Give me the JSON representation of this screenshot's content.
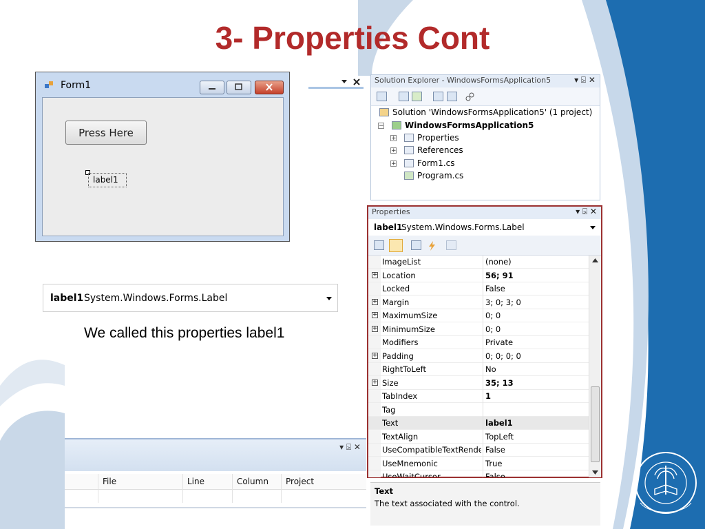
{
  "slide": {
    "title": "3- Properties Cont",
    "caption": "We called this properties label1"
  },
  "form1": {
    "title": "Form1",
    "button_label": "Press Here",
    "label_text": "label1"
  },
  "label_selector": {
    "name": "label1",
    "type": "System.Windows.Forms.Label"
  },
  "error_list": {
    "columns": [
      "File",
      "Line",
      "Column",
      "Project"
    ],
    "controls": "▾ ⍄ ✕"
  },
  "solution_explorer": {
    "title": "Solution Explorer - WindowsFormsApplication5",
    "controls": "▾ ⍄ ✕",
    "solution": "Solution 'WindowsFormsApplication5' (1 project)",
    "project": "WindowsFormsApplication5",
    "items": [
      "Properties",
      "References",
      "Form1.cs",
      "Program.cs"
    ]
  },
  "properties_panel": {
    "title": "Properties",
    "controls": "▾ ⍄ ✕",
    "object_name": "label1",
    "object_type": "System.Windows.Forms.Label",
    "rows": [
      {
        "name": "ImageList",
        "value": "(none)",
        "expandable": false,
        "bold": false
      },
      {
        "name": "Location",
        "value": "56; 91",
        "expandable": true,
        "bold": true
      },
      {
        "name": "Locked",
        "value": "False",
        "expandable": false,
        "bold": false
      },
      {
        "name": "Margin",
        "value": "3; 0; 3; 0",
        "expandable": true,
        "bold": false
      },
      {
        "name": "MaximumSize",
        "value": "0; 0",
        "expandable": true,
        "bold": false
      },
      {
        "name": "MinimumSize",
        "value": "0; 0",
        "expandable": true,
        "bold": false
      },
      {
        "name": "Modifiers",
        "value": "Private",
        "expandable": false,
        "bold": false
      },
      {
        "name": "Padding",
        "value": "0; 0; 0; 0",
        "expandable": true,
        "bold": false
      },
      {
        "name": "RightToLeft",
        "value": "No",
        "expandable": false,
        "bold": false
      },
      {
        "name": "Size",
        "value": "35; 13",
        "expandable": true,
        "bold": true
      },
      {
        "name": "TabIndex",
        "value": "1",
        "expandable": false,
        "bold": true
      },
      {
        "name": "Tag",
        "value": "",
        "expandable": false,
        "bold": false
      },
      {
        "name": "Text",
        "value": "label1",
        "expandable": false,
        "bold": true,
        "selected": true
      },
      {
        "name": "TextAlign",
        "value": "TopLeft",
        "expandable": false,
        "bold": false
      },
      {
        "name": "UseCompatibleTextRendering",
        "value": "False",
        "expandable": false,
        "bold": false
      },
      {
        "name": "UseMnemonic",
        "value": "True",
        "expandable": false,
        "bold": false
      },
      {
        "name": "UseWaitCursor",
        "value": "False",
        "expandable": false,
        "bold": false
      }
    ],
    "description_title": "Text",
    "description_body": "The text associated with the control."
  },
  "colors": {
    "title": "#b22a2a",
    "highlight_border": "#9b3030",
    "sidebar_blue": "#1f6fb2"
  }
}
